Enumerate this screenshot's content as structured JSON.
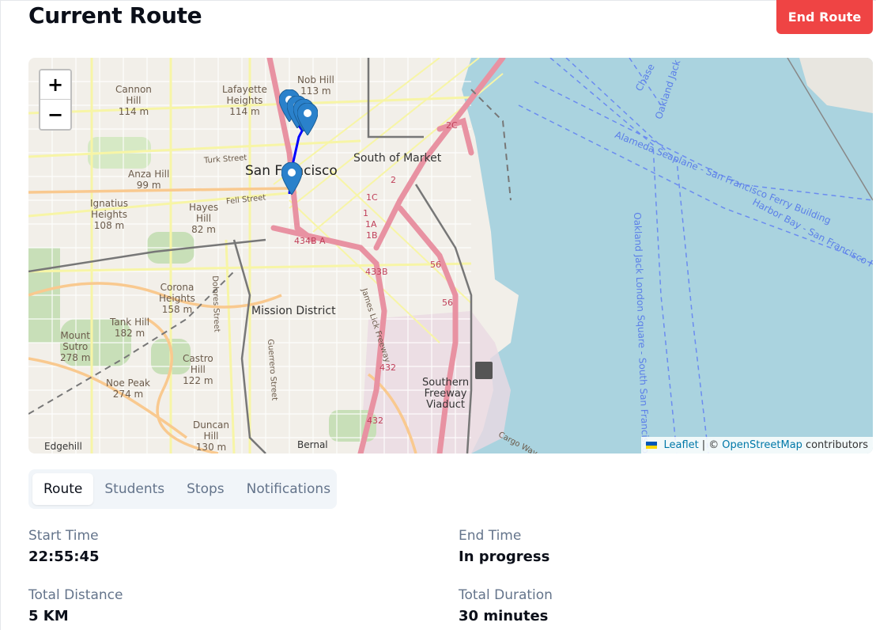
{
  "header": {
    "title": "Current Route",
    "end_button": "End Route"
  },
  "map": {
    "zoom_in": "+",
    "zoom_out": "−",
    "attribution": {
      "leaflet": "Leaflet",
      "sep": "| ©",
      "osm": "OpenStreetMap",
      "suffix": "contributors"
    },
    "labels": {
      "cannon_hill": "Cannon\nHill\n114 m",
      "lafayette": "Lafayette\nHeights\n114 m",
      "nob_hill": "Nob Hill\n113 m",
      "anza": "Anza Hill\n99 m",
      "ignatius": "Ignatius\nHeights\n108 m",
      "hayes": "Hayes\nHill\n82 m",
      "corona": "Corona\nHeights\n158 m",
      "tank_hill": "Tank Hill\n182 m",
      "mount_sutro": "Mount\nSutro\n278 m",
      "castro_hill": "Castro\nHill\n122 m",
      "noe_peak": "Noe Peak\n274 m",
      "duncan_hill": "Duncan\nHill\n130 m",
      "san_francisco": "San Francisco",
      "south_of_market": "South of Market",
      "mission": "Mission District",
      "southern_freeway": "Southern\nFreeway\nViaduct",
      "turk": "Turk Street",
      "fell": "Fell Street",
      "dolores": "Dolores Street",
      "guerrero": "Guerrero Street",
      "james_lick": "James Lick Freeway",
      "bernal": "Bernal",
      "edgehill": "Edgehill",
      "ferry1": "Alameda Seaplane - San Francisco Ferry Building",
      "ferry2": "Harbor Bay - San Francisco F",
      "oakland_sq": "Oakland Jack London Square - South San Francisco",
      "chase": "Chase",
      "oakland_top": "Oakland Jack Lo",
      "cargo": "Cargo Way",
      "r_434BA": "434B A",
      "r_433B": "433B",
      "r_432a": "432",
      "r_432b": "432",
      "r_1C": "1C",
      "r_1B": "1B",
      "r_1A": "1A",
      "r_1": "1",
      "r_2": "2",
      "r_2C": "2C",
      "r_56a": "56",
      "r_56b": "56"
    }
  },
  "tabs": [
    {
      "label": "Route",
      "active": true
    },
    {
      "label": "Students",
      "active": false
    },
    {
      "label": "Stops",
      "active": false
    },
    {
      "label": "Notifications",
      "active": false
    }
  ],
  "details": {
    "start_time": {
      "label": "Start Time",
      "value": "22:55:45"
    },
    "end_time": {
      "label": "End Time",
      "value": "In progress"
    },
    "total_distance": {
      "label": "Total Distance",
      "value": "5 KM"
    },
    "total_duration": {
      "label": "Total Duration",
      "value": "30 minutes"
    }
  },
  "colors": {
    "accent": "#ef4444",
    "route_line": "#0000ff",
    "water": "#aad3df",
    "marker": "#2a81cb"
  }
}
